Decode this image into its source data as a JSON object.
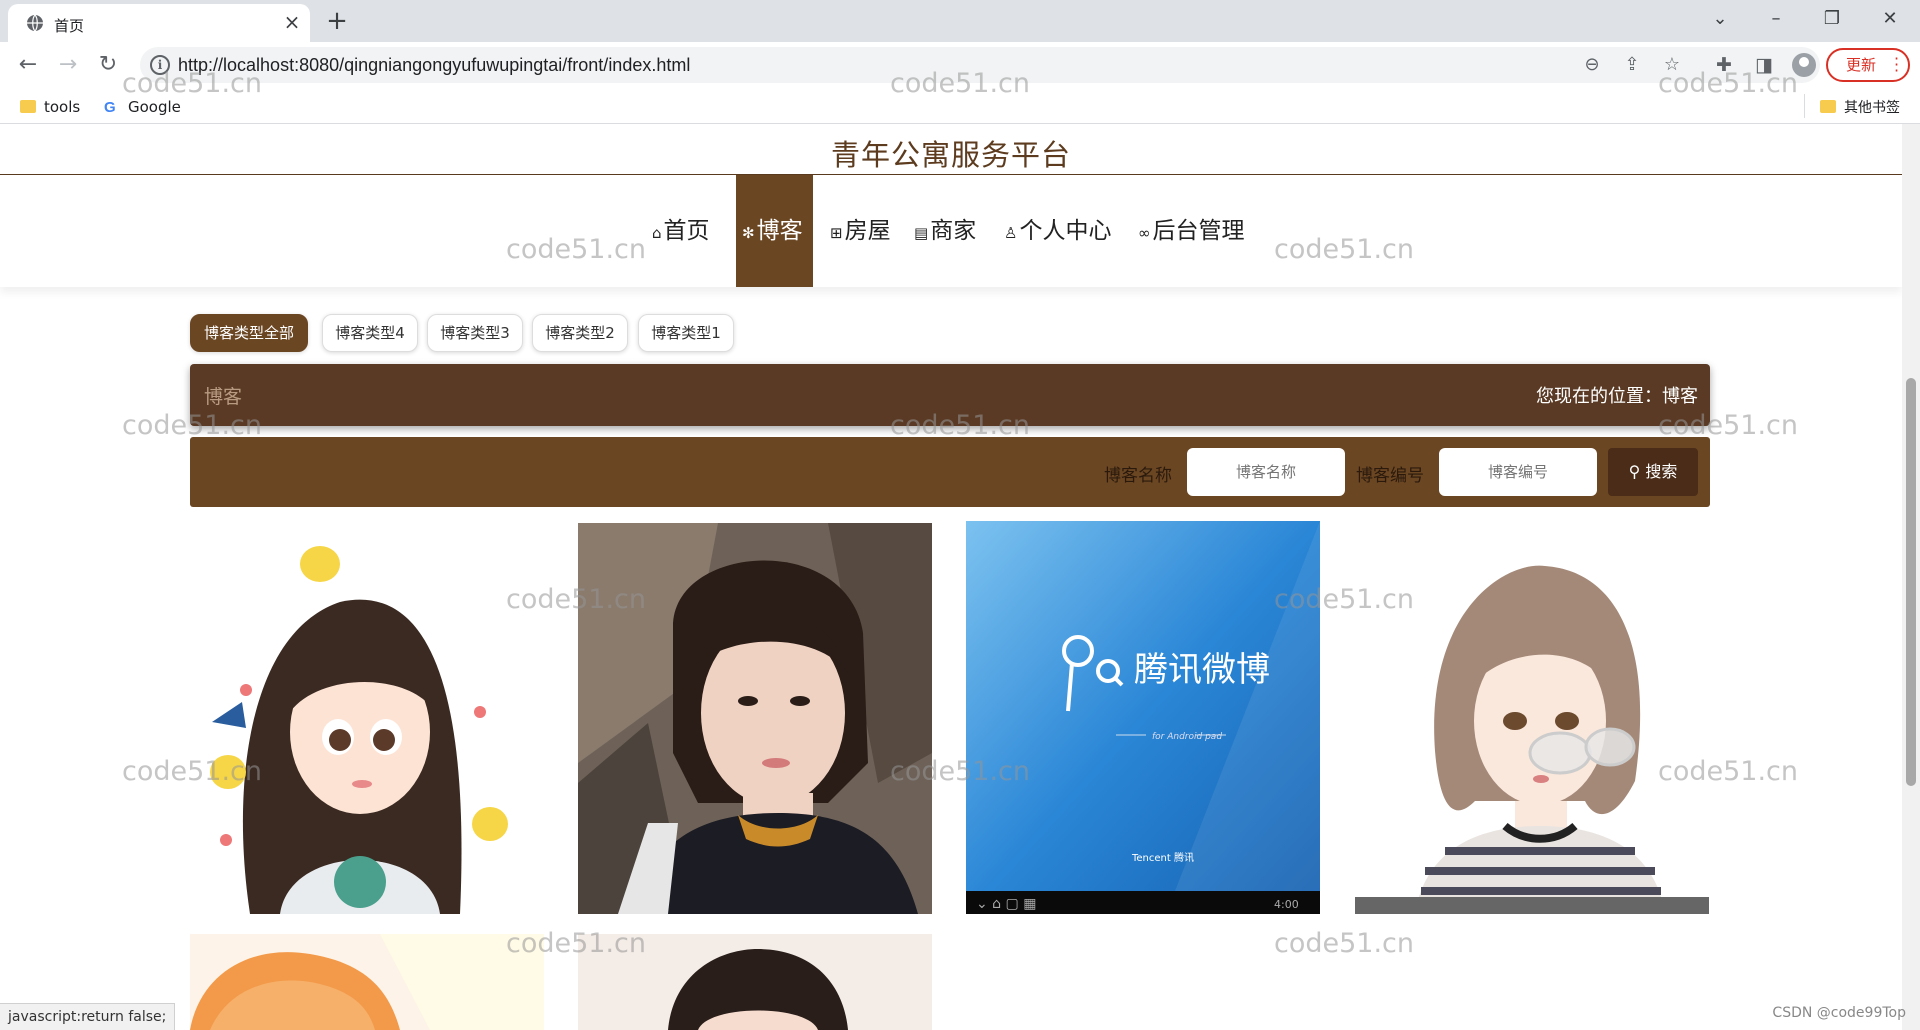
{
  "browser": {
    "tab_title": "首页",
    "url": "http://localhost:8080/qingniangongyufuwupingtai/front/index.html",
    "update_label": "更新",
    "bookmarks": [
      {
        "label": "tools",
        "icon": "folder-icon"
      },
      {
        "label": "Google",
        "icon": "google-icon"
      }
    ],
    "other_bookmarks": "其他书签"
  },
  "site": {
    "title": "青年公寓服务平台",
    "nav": [
      {
        "label": "首页",
        "icon": "home-icon",
        "glyph": "⌂",
        "active": false
      },
      {
        "label": "博客",
        "icon": "snowflake-icon",
        "glyph": "✻",
        "active": true
      },
      {
        "label": "房屋",
        "icon": "gift-icon",
        "glyph": "⊞",
        "active": false
      },
      {
        "label": "商家",
        "icon": "calendar-icon",
        "glyph": "▤",
        "active": false
      },
      {
        "label": "个人中心",
        "icon": "user-icon",
        "glyph": "♙",
        "active": false
      },
      {
        "label": "后台管理",
        "icon": "link-icon",
        "glyph": "∞",
        "active": false
      }
    ]
  },
  "categories": [
    "博客类型全部",
    "博客类型4",
    "博客类型3",
    "博客类型2",
    "博客类型1"
  ],
  "title_bar": {
    "left": "博客",
    "right": "您现在的位置：博客"
  },
  "search": {
    "name_label": "博客名称",
    "name_placeholder": "博客名称",
    "code_label": "博客编号",
    "code_placeholder": "博客编号",
    "button_label": "搜索"
  },
  "cards": [
    {
      "name": "cartoon-girl-waving"
    },
    {
      "name": "girl-photo-rocks"
    },
    {
      "name": "tencent-weibo-screen",
      "logo_text": "腾讯微博",
      "sub_text": "for Android pad",
      "brand": "Tencent 腾讯",
      "clock": "4:00"
    },
    {
      "name": "cartoon-girl-glasses"
    },
    {
      "name": "orange-hair-photo"
    },
    {
      "name": "girl-bangs-photo"
    }
  ],
  "watermark": "code51.cn",
  "status_text": "javascript:return false;",
  "csdn_credit": "CSDN @code99Top",
  "colors": {
    "brand_brown": "#6b4623",
    "dark_brown": "#5a3a24",
    "update_red": "#d93025"
  }
}
